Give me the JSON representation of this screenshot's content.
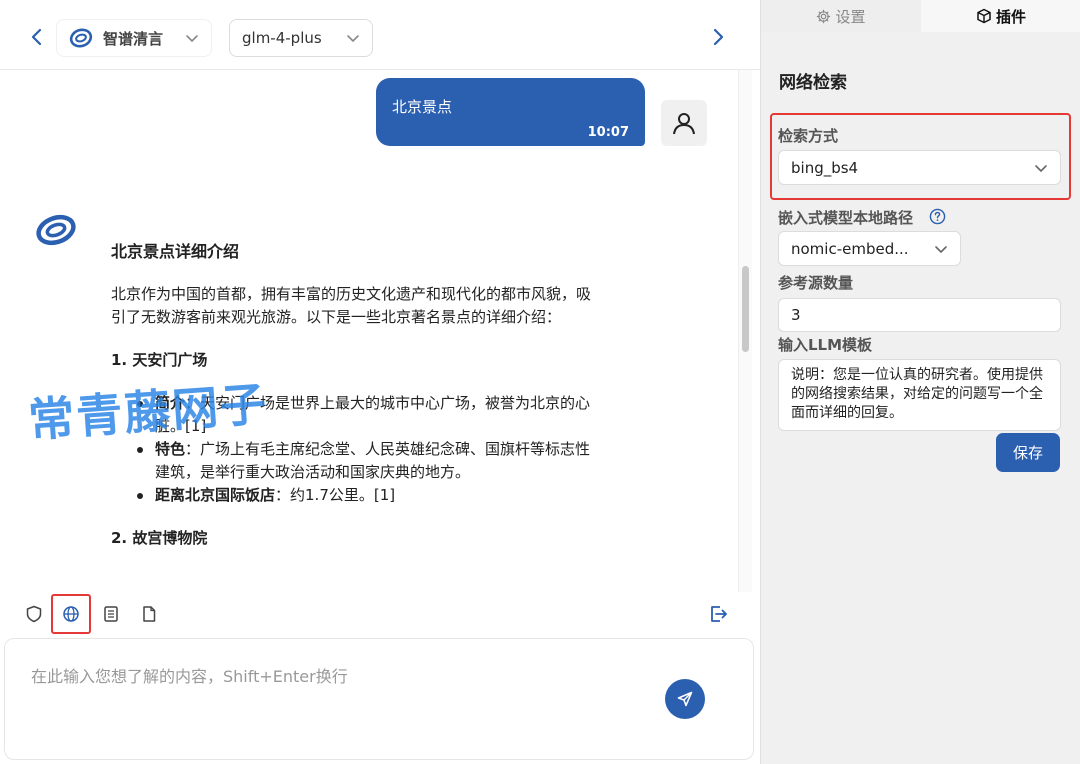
{
  "header": {
    "provider": "智谱清言",
    "model": "glm-4-plus"
  },
  "chat": {
    "user_message": "北京景点",
    "user_time": "10:07",
    "bot": {
      "title": "北京景点详细介绍",
      "intro": "北京作为中国的首都，拥有丰富的历史文化遗产和现代化的都市风貌，吸引了无数游客前来观光旅游。以下是一些北京著名景点的详细介绍：",
      "section1": "1. 天安门广场",
      "items": [
        {
          "key": "简介",
          "text": "：天安门广场是世界上最大的城市中心广场，被誉为北京的心脏。[1]"
        },
        {
          "key": "特色",
          "text": "：广场上有毛主席纪念堂、人民英雄纪念碑、国旗杆等标志性建筑，是举行重大政治活动和国家庆典的地方。"
        },
        {
          "key": "距离北京国际饭店",
          "text": "：约1.7公里。[1]"
        }
      ],
      "section2": "2. 故宫博物院"
    },
    "watermark": "常青藤网子"
  },
  "input": {
    "placeholder": "在此输入您想了解的内容，Shift+Enter换行"
  },
  "side": {
    "tabs": {
      "settings": "设置",
      "plugins": "插件"
    },
    "title": "网络检索",
    "search_method_label": "检索方式",
    "search_method_value": "bing_bs4",
    "embed_path_label": "嵌入式模型本地路径",
    "embed_path_value": "nomic-embed...",
    "ref_count_label": "参考源数量",
    "ref_count_value": "3",
    "template_label": "输入LLM模板",
    "template_value": "说明：您是一位认真的研究者。使用提供的网络搜索结果，对给定的问题写一个全面而详细的回复。",
    "save_label": "保存"
  },
  "colors": {
    "accent": "#2b5fb0",
    "highlight": "#e53935",
    "panel_bg": "#f0f0f0"
  }
}
